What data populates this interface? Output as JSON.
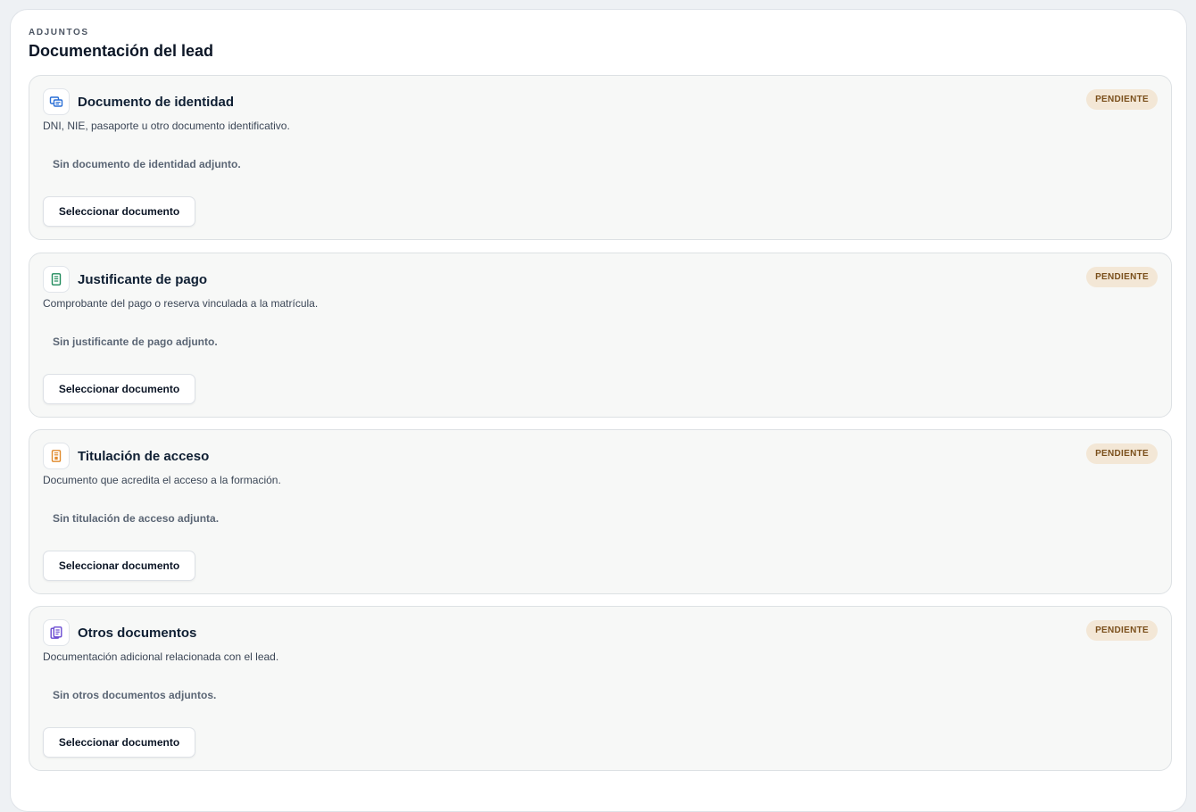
{
  "panel": {
    "eyebrow": "ADJUNTOS",
    "title": "Documentación del lead"
  },
  "colors": {
    "badge_bg": "#f3e7d6",
    "badge_text": "#7a4f1b",
    "identity_icon": "#2a6fd6",
    "payment_icon": "#1f8a5b",
    "access_icon": "#e08a2c",
    "others_icon": "#6a4ad1"
  },
  "documents": [
    {
      "icon": "id-card-icon",
      "title": "Documento de identidad",
      "description": "DNI, NIE, pasaporte u otro documento identificativo.",
      "empty_note": "Sin documento de identidad adjunto.",
      "button_label": "Seleccionar documento",
      "status": "PENDIENTE"
    },
    {
      "icon": "receipt-icon",
      "title": "Justificante de pago",
      "description": "Comprobante del pago o reserva vinculada a la matrícula.",
      "empty_note": "Sin justificante de pago adjunto.",
      "button_label": "Seleccionar documento",
      "status": "PENDIENTE"
    },
    {
      "icon": "certificate-icon",
      "title": "Titulación de acceso",
      "description": "Documento que acredita el acceso a la formación.",
      "empty_note": "Sin titulación de acceso adjunta.",
      "button_label": "Seleccionar documento",
      "status": "PENDIENTE"
    },
    {
      "icon": "files-icon",
      "title": "Otros documentos",
      "description": "Documentación adicional relacionada con el lead.",
      "empty_note": "Sin otros documentos adjuntos.",
      "button_label": "Seleccionar documento",
      "status": "PENDIENTE"
    }
  ]
}
